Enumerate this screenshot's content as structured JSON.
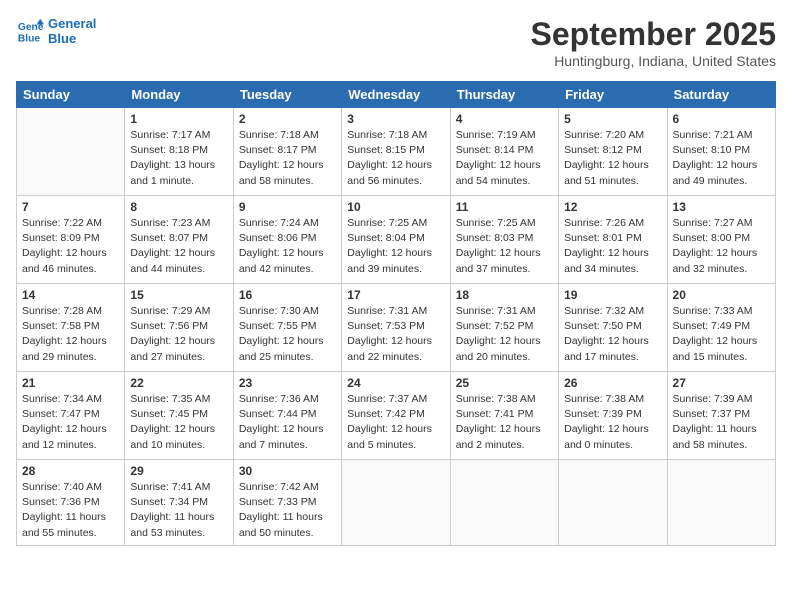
{
  "logo": {
    "line1": "General",
    "line2": "Blue"
  },
  "title": "September 2025",
  "location": "Huntingburg, Indiana, United States",
  "weekdays": [
    "Sunday",
    "Monday",
    "Tuesday",
    "Wednesday",
    "Thursday",
    "Friday",
    "Saturday"
  ],
  "weeks": [
    [
      {
        "day": "",
        "info": ""
      },
      {
        "day": "1",
        "info": "Sunrise: 7:17 AM\nSunset: 8:18 PM\nDaylight: 13 hours\nand 1 minute."
      },
      {
        "day": "2",
        "info": "Sunrise: 7:18 AM\nSunset: 8:17 PM\nDaylight: 12 hours\nand 58 minutes."
      },
      {
        "day": "3",
        "info": "Sunrise: 7:18 AM\nSunset: 8:15 PM\nDaylight: 12 hours\nand 56 minutes."
      },
      {
        "day": "4",
        "info": "Sunrise: 7:19 AM\nSunset: 8:14 PM\nDaylight: 12 hours\nand 54 minutes."
      },
      {
        "day": "5",
        "info": "Sunrise: 7:20 AM\nSunset: 8:12 PM\nDaylight: 12 hours\nand 51 minutes."
      },
      {
        "day": "6",
        "info": "Sunrise: 7:21 AM\nSunset: 8:10 PM\nDaylight: 12 hours\nand 49 minutes."
      }
    ],
    [
      {
        "day": "7",
        "info": "Sunrise: 7:22 AM\nSunset: 8:09 PM\nDaylight: 12 hours\nand 46 minutes."
      },
      {
        "day": "8",
        "info": "Sunrise: 7:23 AM\nSunset: 8:07 PM\nDaylight: 12 hours\nand 44 minutes."
      },
      {
        "day": "9",
        "info": "Sunrise: 7:24 AM\nSunset: 8:06 PM\nDaylight: 12 hours\nand 42 minutes."
      },
      {
        "day": "10",
        "info": "Sunrise: 7:25 AM\nSunset: 8:04 PM\nDaylight: 12 hours\nand 39 minutes."
      },
      {
        "day": "11",
        "info": "Sunrise: 7:25 AM\nSunset: 8:03 PM\nDaylight: 12 hours\nand 37 minutes."
      },
      {
        "day": "12",
        "info": "Sunrise: 7:26 AM\nSunset: 8:01 PM\nDaylight: 12 hours\nand 34 minutes."
      },
      {
        "day": "13",
        "info": "Sunrise: 7:27 AM\nSunset: 8:00 PM\nDaylight: 12 hours\nand 32 minutes."
      }
    ],
    [
      {
        "day": "14",
        "info": "Sunrise: 7:28 AM\nSunset: 7:58 PM\nDaylight: 12 hours\nand 29 minutes."
      },
      {
        "day": "15",
        "info": "Sunrise: 7:29 AM\nSunset: 7:56 PM\nDaylight: 12 hours\nand 27 minutes."
      },
      {
        "day": "16",
        "info": "Sunrise: 7:30 AM\nSunset: 7:55 PM\nDaylight: 12 hours\nand 25 minutes."
      },
      {
        "day": "17",
        "info": "Sunrise: 7:31 AM\nSunset: 7:53 PM\nDaylight: 12 hours\nand 22 minutes."
      },
      {
        "day": "18",
        "info": "Sunrise: 7:31 AM\nSunset: 7:52 PM\nDaylight: 12 hours\nand 20 minutes."
      },
      {
        "day": "19",
        "info": "Sunrise: 7:32 AM\nSunset: 7:50 PM\nDaylight: 12 hours\nand 17 minutes."
      },
      {
        "day": "20",
        "info": "Sunrise: 7:33 AM\nSunset: 7:49 PM\nDaylight: 12 hours\nand 15 minutes."
      }
    ],
    [
      {
        "day": "21",
        "info": "Sunrise: 7:34 AM\nSunset: 7:47 PM\nDaylight: 12 hours\nand 12 minutes."
      },
      {
        "day": "22",
        "info": "Sunrise: 7:35 AM\nSunset: 7:45 PM\nDaylight: 12 hours\nand 10 minutes."
      },
      {
        "day": "23",
        "info": "Sunrise: 7:36 AM\nSunset: 7:44 PM\nDaylight: 12 hours\nand 7 minutes."
      },
      {
        "day": "24",
        "info": "Sunrise: 7:37 AM\nSunset: 7:42 PM\nDaylight: 12 hours\nand 5 minutes."
      },
      {
        "day": "25",
        "info": "Sunrise: 7:38 AM\nSunset: 7:41 PM\nDaylight: 12 hours\nand 2 minutes."
      },
      {
        "day": "26",
        "info": "Sunrise: 7:38 AM\nSunset: 7:39 PM\nDaylight: 12 hours\nand 0 minutes."
      },
      {
        "day": "27",
        "info": "Sunrise: 7:39 AM\nSunset: 7:37 PM\nDaylight: 11 hours\nand 58 minutes."
      }
    ],
    [
      {
        "day": "28",
        "info": "Sunrise: 7:40 AM\nSunset: 7:36 PM\nDaylight: 11 hours\nand 55 minutes."
      },
      {
        "day": "29",
        "info": "Sunrise: 7:41 AM\nSunset: 7:34 PM\nDaylight: 11 hours\nand 53 minutes."
      },
      {
        "day": "30",
        "info": "Sunrise: 7:42 AM\nSunset: 7:33 PM\nDaylight: 11 hours\nand 50 minutes."
      },
      {
        "day": "",
        "info": ""
      },
      {
        "day": "",
        "info": ""
      },
      {
        "day": "",
        "info": ""
      },
      {
        "day": "",
        "info": ""
      }
    ]
  ]
}
